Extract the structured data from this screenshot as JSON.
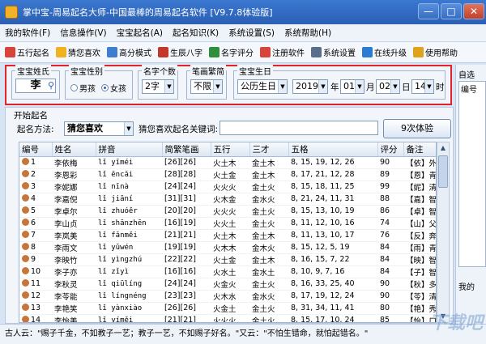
{
  "window": {
    "title": "掌中宝-周易起名大师-中国最棒的周易起名软件 [V9.7.8体验版]",
    "controls": [
      "—",
      "□",
      "✕"
    ]
  },
  "menu": [
    "我的软件(F)",
    "信息操作(V)",
    "宝宝起名(A)",
    "起名知识(K)",
    "系统设置(S)",
    "系统帮助(H)"
  ],
  "toolbar": [
    {
      "label": "五行起名",
      "icon": "five-elements-icon",
      "color": "#d8433a"
    },
    {
      "label": "猜您喜欢",
      "icon": "star-icon",
      "color": "#f0b21e"
    },
    {
      "label": "高分模式",
      "icon": "chart-icon",
      "color": "#3f7dd0"
    },
    {
      "label": "生辰八字",
      "icon": "calendar-icon",
      "color": "#c0392b"
    },
    {
      "label": "名字评分",
      "icon": "score-icon",
      "color": "#2f8f3a"
    },
    {
      "label": "注册软件",
      "icon": "register-icon",
      "color": "#d8433a"
    },
    {
      "label": "系统设置",
      "icon": "settings-icon",
      "color": "#5a6e8c"
    },
    {
      "label": "在线升级",
      "icon": "globe-icon",
      "color": "#2a7bd4"
    },
    {
      "label": "使用帮助",
      "icon": "help-icon",
      "color": "#e0a21a"
    }
  ],
  "settings": {
    "surname_caption": "宝宝姓氏",
    "surname_value": "李",
    "gender_caption": "宝宝性别",
    "gender_options": [
      "男孩",
      "女孩"
    ],
    "gender_selected": "女孩",
    "count_caption": "名字个数",
    "count_value": "2字",
    "strokes_caption": "笔画繁简",
    "strokes_value": "不限",
    "birth_caption": "宝宝生日",
    "calendar_value": "公历生日",
    "year": "2019",
    "year_unit": "年",
    "month": "01",
    "month_unit": "月",
    "day": "02",
    "day_unit": "日",
    "hour": "14",
    "hour_unit": "时"
  },
  "start": {
    "caption": "开始起名",
    "method_label": "起名方法:",
    "method_value": "猜您喜欢",
    "keyword_label": "猜您喜欢起名关键词:",
    "keyword_value": "",
    "button_label": "9次体验"
  },
  "table": {
    "columns": [
      "编号",
      "姓名",
      "拼音",
      "简繁笔画",
      "五行",
      "三才",
      "五格",
      "评分",
      "备注"
    ],
    "rows": [
      [
        "1",
        "李依梅",
        "lǐ yīméi",
        "[26][26]",
        "火土木",
        "金土木",
        "8, 15, 19, 12, 26",
        "90",
        "【依】外观秀"
      ],
      [
        "2",
        "李恩彩",
        "lǐ ēncǎi",
        "[28][28]",
        "火土金",
        "金土木",
        "8, 17, 21, 12, 28",
        "89",
        "【恩】青雅仁"
      ],
      [
        "3",
        "李妮娜",
        "lǐ nīnà",
        "[24][24]",
        "火火火",
        "金土火",
        "8, 15, 18, 11, 25",
        "99",
        "【妮】清雅伶"
      ],
      [
        "4",
        "李嘉倪",
        "lǐ jiāní",
        "[31][31]",
        "火木金",
        "金水火",
        "8, 21, 24, 11, 31",
        "88",
        "【嘉】智无"
      ],
      [
        "5",
        "李卓尔",
        "lǐ zhuóěr",
        "[20][20]",
        "火火火",
        "金土火",
        "8, 15, 13, 10, 19",
        "86",
        "【卓】智无"
      ],
      [
        "6",
        "李山贞",
        "lǐ shānzhēn",
        "[16][19]",
        "火火土",
        "金土火",
        "8, 11, 12, 10, 16",
        "74",
        "【山】父母无"
      ],
      [
        "7",
        "李岚美",
        "lǐ fǎnměi",
        "[21][21]",
        "火土木",
        "金土木",
        "8, 11, 13, 10, 17",
        "76",
        "【反】奔波劳"
      ],
      [
        "8",
        "李雨文",
        "lǐ yǔwén",
        "[19][19]",
        "火木木",
        "金木火",
        "8, 15, 12, 5, 19",
        "84",
        "【雨】青雅伶"
      ],
      [
        "9",
        "李映竹",
        "lǐ yìngzhú",
        "[22][22]",
        "火土金",
        "金土木",
        "8, 16, 15, 7, 22",
        "84",
        "【映】智勇双"
      ],
      [
        "10",
        "李子亦",
        "lǐ zǐyì",
        "[16][16]",
        "火水土",
        "金水土",
        "8, 10, 9, 7, 16",
        "84",
        "【子】智勇双"
      ],
      [
        "11",
        "李秋灵",
        "lǐ qiūlíng",
        "[24][24]",
        "火金火",
        "金土火",
        "8, 16, 33, 25, 40",
        "90",
        "【秋】多才技"
      ],
      [
        "12",
        "李苓能",
        "lǐ língnéng",
        "[23][23]",
        "火木水",
        "金水火",
        "8, 17, 19, 12, 24",
        "90",
        "【苓】清雅伶"
      ],
      [
        "13",
        "李艳笑",
        "lǐ yànxiào",
        "[26][26]",
        "火金土",
        "金土火",
        "8, 31, 34, 11, 41",
        "80",
        "【艳】秀气伶"
      ],
      [
        "14",
        "李怡美",
        "lǐ yíměi",
        "[21][21]",
        "火火火",
        "金土火",
        "8, 15, 17, 10, 24",
        "85",
        "【怡】口快心"
      ],
      [
        "15",
        "李嘉壹",
        "lǐ jiāyī",
        "[28][28]",
        "火木土",
        "金木土",
        "8, 21, 33, 19, 40",
        "81",
        "【嘉】智无"
      ]
    ]
  },
  "side": {
    "top_label": "自选",
    "list_label": "编号",
    "bottom_label": "我的"
  },
  "status": "古人云：\"赐子千金，不如教子一艺；教子一艺，不如赐子好名。\"又云：\"不怕生错命，就怕起错名。\"",
  "watermark": "下载吧"
}
